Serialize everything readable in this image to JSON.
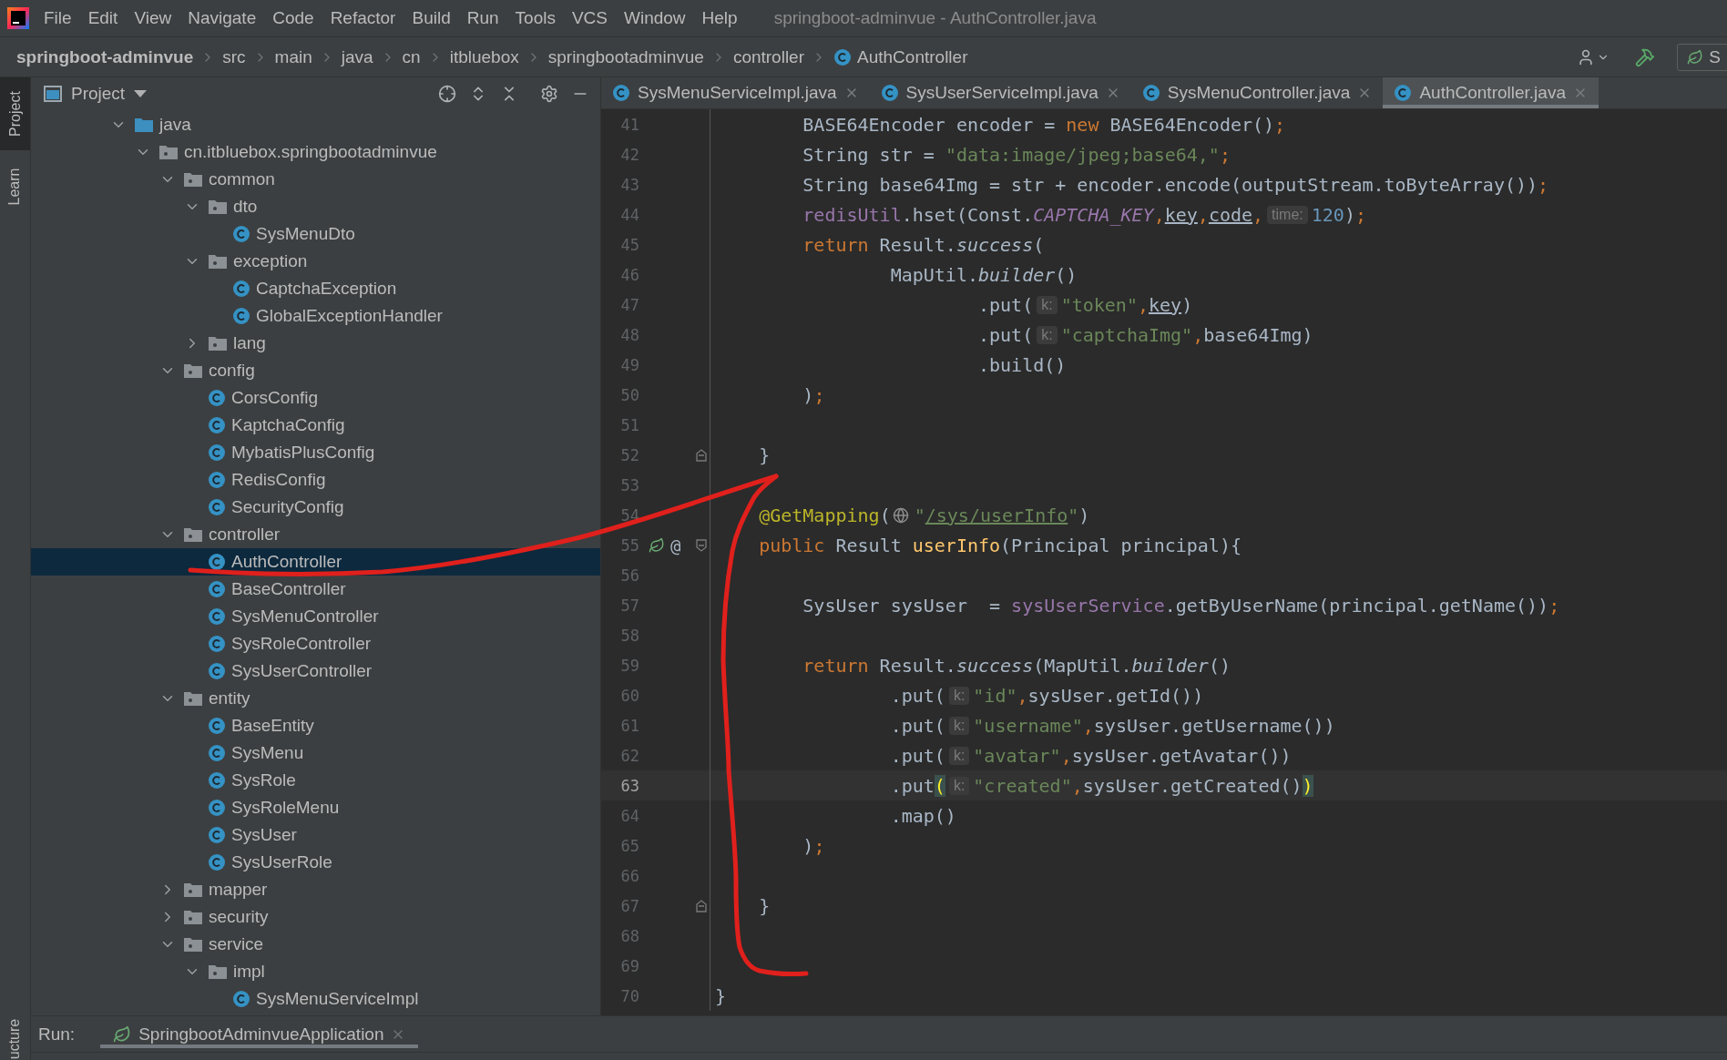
{
  "menu_bar": {
    "items": [
      "File",
      "Edit",
      "View",
      "Navigate",
      "Code",
      "Refactor",
      "Build",
      "Run",
      "Tools",
      "VCS",
      "Window",
      "Help"
    ],
    "title": "springboot-adminvue - AuthController.java"
  },
  "breadcrumbs": [
    {
      "label": "springboot-adminvue",
      "kind": "project"
    },
    {
      "label": "src",
      "kind": "folder"
    },
    {
      "label": "main",
      "kind": "folder"
    },
    {
      "label": "java",
      "kind": "folder"
    },
    {
      "label": "cn",
      "kind": "folder"
    },
    {
      "label": "itbluebox",
      "kind": "folder"
    },
    {
      "label": "springbootadminvue",
      "kind": "folder"
    },
    {
      "label": "controller",
      "kind": "folder"
    },
    {
      "label": "AuthController",
      "kind": "class"
    }
  ],
  "toolbar": {
    "run_config": "S"
  },
  "side_stripe": {
    "tabs": [
      {
        "label": "Project",
        "selected": true
      },
      {
        "label": "Learn",
        "selected": false
      }
    ],
    "bottom_tab": "ucture"
  },
  "project_panel": {
    "title": "Project",
    "tree": [
      {
        "label": "java",
        "kind": "source",
        "expanded": true,
        "selected": false,
        "children": [
          {
            "label": "cn.itbluebox.springbootadminvue",
            "kind": "package",
            "expanded": true,
            "selected": false,
            "children": [
              {
                "label": "common",
                "kind": "package",
                "expanded": true,
                "selected": false,
                "children": [
                  {
                    "label": "dto",
                    "kind": "package",
                    "expanded": true,
                    "selected": false,
                    "children": [
                      {
                        "label": "SysMenuDto",
                        "kind": "class",
                        "selected": false
                      }
                    ]
                  },
                  {
                    "label": "exception",
                    "kind": "package",
                    "expanded": true,
                    "selected": false,
                    "children": [
                      {
                        "label": "CaptchaException",
                        "kind": "class",
                        "selected": false
                      },
                      {
                        "label": "GlobalExceptionHandler",
                        "kind": "class",
                        "selected": false
                      }
                    ]
                  },
                  {
                    "label": "lang",
                    "kind": "package",
                    "expanded": false,
                    "selected": false
                  }
                ]
              },
              {
                "label": "config",
                "kind": "package",
                "expanded": true,
                "selected": false,
                "children": [
                  {
                    "label": "CorsConfig",
                    "kind": "class",
                    "selected": false
                  },
                  {
                    "label": "KaptchaConfig",
                    "kind": "class",
                    "selected": false
                  },
                  {
                    "label": "MybatisPlusConfig",
                    "kind": "class",
                    "selected": false
                  },
                  {
                    "label": "RedisConfig",
                    "kind": "class",
                    "selected": false
                  },
                  {
                    "label": "SecurityConfig",
                    "kind": "class",
                    "selected": false
                  }
                ]
              },
              {
                "label": "controller",
                "kind": "package",
                "expanded": true,
                "selected": false,
                "children": [
                  {
                    "label": "AuthController",
                    "kind": "class",
                    "selected": true
                  },
                  {
                    "label": "BaseController",
                    "kind": "class",
                    "selected": false
                  },
                  {
                    "label": "SysMenuController",
                    "kind": "class",
                    "selected": false
                  },
                  {
                    "label": "SysRoleController",
                    "kind": "class",
                    "selected": false
                  },
                  {
                    "label": "SysUserController",
                    "kind": "class",
                    "selected": false
                  }
                ]
              },
              {
                "label": "entity",
                "kind": "package",
                "expanded": true,
                "selected": false,
                "children": [
                  {
                    "label": "BaseEntity",
                    "kind": "class",
                    "selected": false
                  },
                  {
                    "label": "SysMenu",
                    "kind": "class",
                    "selected": false
                  },
                  {
                    "label": "SysRole",
                    "kind": "class",
                    "selected": false
                  },
                  {
                    "label": "SysRoleMenu",
                    "kind": "class",
                    "selected": false
                  },
                  {
                    "label": "SysUser",
                    "kind": "class",
                    "selected": false
                  },
                  {
                    "label": "SysUserRole",
                    "kind": "class",
                    "selected": false
                  }
                ]
              },
              {
                "label": "mapper",
                "kind": "package",
                "expanded": false,
                "selected": false
              },
              {
                "label": "security",
                "kind": "package",
                "expanded": false,
                "selected": false
              },
              {
                "label": "service",
                "kind": "package",
                "expanded": true,
                "selected": false,
                "children": [
                  {
                    "label": "impl",
                    "kind": "package",
                    "expanded": true,
                    "selected": false,
                    "children": [
                      {
                        "label": "SysMenuServiceImpl",
                        "kind": "class",
                        "selected": false
                      }
                    ]
                  }
                ]
              }
            ]
          }
        ]
      }
    ]
  },
  "editor": {
    "tabs": [
      {
        "label": "SysMenuServiceImpl.java",
        "selected": false
      },
      {
        "label": "SysUserServiceImpl.java",
        "selected": false
      },
      {
        "label": "SysMenuController.java",
        "selected": false
      },
      {
        "label": "AuthController.java",
        "selected": true
      }
    ],
    "lines": [
      {
        "number": "41",
        "current": false,
        "tokens": [
          {
            "kind": "plain",
            "text": "        BASE64Encoder encoder = "
          },
          {
            "kind": "keyword",
            "text": "new"
          },
          {
            "kind": "plain",
            "text": " BASE64Encoder()"
          },
          {
            "kind": "keyword",
            "text": ";"
          }
        ]
      },
      {
        "number": "42",
        "current": false,
        "tokens": [
          {
            "kind": "plain",
            "text": "        String str = "
          },
          {
            "kind": "string",
            "text": "\"data:image/jpeg;base64,\""
          },
          {
            "kind": "keyword",
            "text": ";"
          }
        ]
      },
      {
        "number": "43",
        "current": false,
        "tokens": [
          {
            "kind": "plain",
            "text": "        String base64Img = str + encoder.encode(outputStream.toByteArray())"
          },
          {
            "kind": "keyword",
            "text": ";"
          }
        ]
      },
      {
        "number": "44",
        "current": false,
        "tokens": [
          {
            "kind": "field",
            "text": "        redisUtil"
          },
          {
            "kind": "plain",
            "text": ".hset(Const."
          },
          {
            "kind": "const",
            "text": "CAPTCHA_KEY"
          },
          {
            "kind": "keyword",
            "text": ","
          },
          {
            "kind": "underlined",
            "text": "key"
          },
          {
            "kind": "keyword",
            "text": ","
          },
          {
            "kind": "underlined",
            "text": "code"
          },
          {
            "kind": "keyword",
            "text": ","
          },
          {
            "kind": "hint",
            "text": "time:"
          },
          {
            "kind": "number",
            "text": "120"
          },
          {
            "kind": "plain",
            "text": ")"
          },
          {
            "kind": "keyword",
            "text": ";"
          }
        ]
      },
      {
        "number": "45",
        "current": false,
        "tokens": [
          {
            "kind": "keyword",
            "text": "        return"
          },
          {
            "kind": "plain",
            "text": " Result."
          },
          {
            "kind": "static",
            "text": "success"
          },
          {
            "kind": "plain",
            "text": "("
          }
        ]
      },
      {
        "number": "46",
        "current": false,
        "tokens": [
          {
            "kind": "plain",
            "text": "                MapUtil."
          },
          {
            "kind": "static",
            "text": "builder"
          },
          {
            "kind": "plain",
            "text": "()"
          }
        ]
      },
      {
        "number": "47",
        "current": false,
        "tokens": [
          {
            "kind": "plain",
            "text": "                        .put("
          },
          {
            "kind": "hint",
            "text": "k:"
          },
          {
            "kind": "string",
            "text": "\"token\""
          },
          {
            "kind": "keyword",
            "text": ","
          },
          {
            "kind": "underlined",
            "text": "key"
          },
          {
            "kind": "plain",
            "text": ")"
          }
        ]
      },
      {
        "number": "48",
        "current": false,
        "tokens": [
          {
            "kind": "plain",
            "text": "                        .put("
          },
          {
            "kind": "hint",
            "text": "k:"
          },
          {
            "kind": "string",
            "text": "\"captchaImg\""
          },
          {
            "kind": "keyword",
            "text": ","
          },
          {
            "kind": "plain",
            "text": "base64Img)"
          }
        ]
      },
      {
        "number": "49",
        "current": false,
        "tokens": [
          {
            "kind": "plain",
            "text": "                        .build()"
          }
        ]
      },
      {
        "number": "50",
        "current": false,
        "tokens": [
          {
            "kind": "plain",
            "text": "        )"
          },
          {
            "kind": "keyword",
            "text": ";"
          }
        ]
      },
      {
        "number": "51",
        "current": false
      },
      {
        "number": "52",
        "current": false,
        "gutter": [
          {
            "kind": "fold-end"
          }
        ],
        "tokens": [
          {
            "kind": "plain",
            "text": "    }"
          }
        ]
      },
      {
        "number": "53",
        "current": false
      },
      {
        "number": "54",
        "current": false,
        "tokens": [
          {
            "kind": "annotation",
            "text": "    @GetMapping"
          },
          {
            "kind": "plain",
            "text": "("
          },
          {
            "kind": "web"
          },
          {
            "kind": "string",
            "text": "\""
          },
          {
            "kind": "link",
            "text": "/sys/userInfo"
          },
          {
            "kind": "string",
            "text": "\""
          },
          {
            "kind": "plain",
            "text": ")"
          }
        ]
      },
      {
        "number": "55",
        "current": false,
        "gutter": [
          {
            "kind": "bean"
          },
          {
            "kind": "text",
            "text": "@"
          },
          {
            "kind": "fold-start"
          }
        ],
        "tokens": [
          {
            "kind": "keyword",
            "text": "    public"
          },
          {
            "kind": "plain",
            "text": " Result "
          },
          {
            "kind": "method",
            "text": "userInfo"
          },
          {
            "kind": "plain",
            "text": "(Principal principal){"
          }
        ]
      },
      {
        "number": "56",
        "current": false
      },
      {
        "number": "57",
        "current": false,
        "tokens": [
          {
            "kind": "plain",
            "text": "        SysUser sysUser  = "
          },
          {
            "kind": "field",
            "text": "sysUserService"
          },
          {
            "kind": "plain",
            "text": ".getByUserName(principal.getName())"
          },
          {
            "kind": "keyword",
            "text": ";"
          }
        ]
      },
      {
        "number": "58",
        "current": false
      },
      {
        "number": "59",
        "current": false,
        "tokens": [
          {
            "kind": "keyword",
            "text": "        return"
          },
          {
            "kind": "plain",
            "text": " Result."
          },
          {
            "kind": "static",
            "text": "success"
          },
          {
            "kind": "plain",
            "text": "(MapUtil."
          },
          {
            "kind": "static",
            "text": "builder"
          },
          {
            "kind": "plain",
            "text": "()"
          }
        ]
      },
      {
        "number": "60",
        "current": false,
        "tokens": [
          {
            "kind": "plain",
            "text": "                .put("
          },
          {
            "kind": "hint",
            "text": "k:"
          },
          {
            "kind": "string",
            "text": "\"id\""
          },
          {
            "kind": "keyword",
            "text": ","
          },
          {
            "kind": "plain",
            "text": "sysUser.getId())"
          }
        ]
      },
      {
        "number": "61",
        "current": false,
        "tokens": [
          {
            "kind": "plain",
            "text": "                .put("
          },
          {
            "kind": "hint",
            "text": "k:"
          },
          {
            "kind": "string",
            "text": "\"username\""
          },
          {
            "kind": "keyword",
            "text": ","
          },
          {
            "kind": "plain",
            "text": "sysUser.getUsername())"
          }
        ]
      },
      {
        "number": "62",
        "current": false,
        "tokens": [
          {
            "kind": "plain",
            "text": "                .put("
          },
          {
            "kind": "hint",
            "text": "k:"
          },
          {
            "kind": "string",
            "text": "\"avatar\""
          },
          {
            "kind": "keyword",
            "text": ","
          },
          {
            "kind": "plain",
            "text": "sysUser.getAvatar())"
          }
        ]
      },
      {
        "number": "63",
        "current": true,
        "tokens": [
          {
            "kind": "plain",
            "text": "                .put"
          },
          {
            "kind": "bracket",
            "text": "("
          },
          {
            "kind": "hint",
            "text": "k:"
          },
          {
            "kind": "string",
            "text": "\"created\""
          },
          {
            "kind": "keyword",
            "text": ","
          },
          {
            "kind": "plain",
            "text": "sysUser.getCreated()"
          },
          {
            "kind": "bracket",
            "text": ")"
          }
        ]
      },
      {
        "number": "64",
        "current": false,
        "tokens": [
          {
            "kind": "plain",
            "text": "                .map()"
          }
        ]
      },
      {
        "number": "65",
        "current": false,
        "tokens": [
          {
            "kind": "plain",
            "text": "        )"
          },
          {
            "kind": "keyword",
            "text": ";"
          }
        ]
      },
      {
        "number": "66",
        "current": false
      },
      {
        "number": "67",
        "current": false,
        "gutter": [
          {
            "kind": "fold-end"
          }
        ],
        "tokens": [
          {
            "kind": "plain",
            "text": "    }"
          }
        ]
      },
      {
        "number": "68",
        "current": false
      },
      {
        "number": "69",
        "current": false
      },
      {
        "number": "70",
        "current": false,
        "tokens": [
          {
            "kind": "plain",
            "text": "}"
          }
        ]
      }
    ]
  },
  "run_bar": {
    "label": "Run:",
    "tabs": [
      {
        "label": "SpringbootAdminvueApplication",
        "selected": true
      }
    ]
  }
}
